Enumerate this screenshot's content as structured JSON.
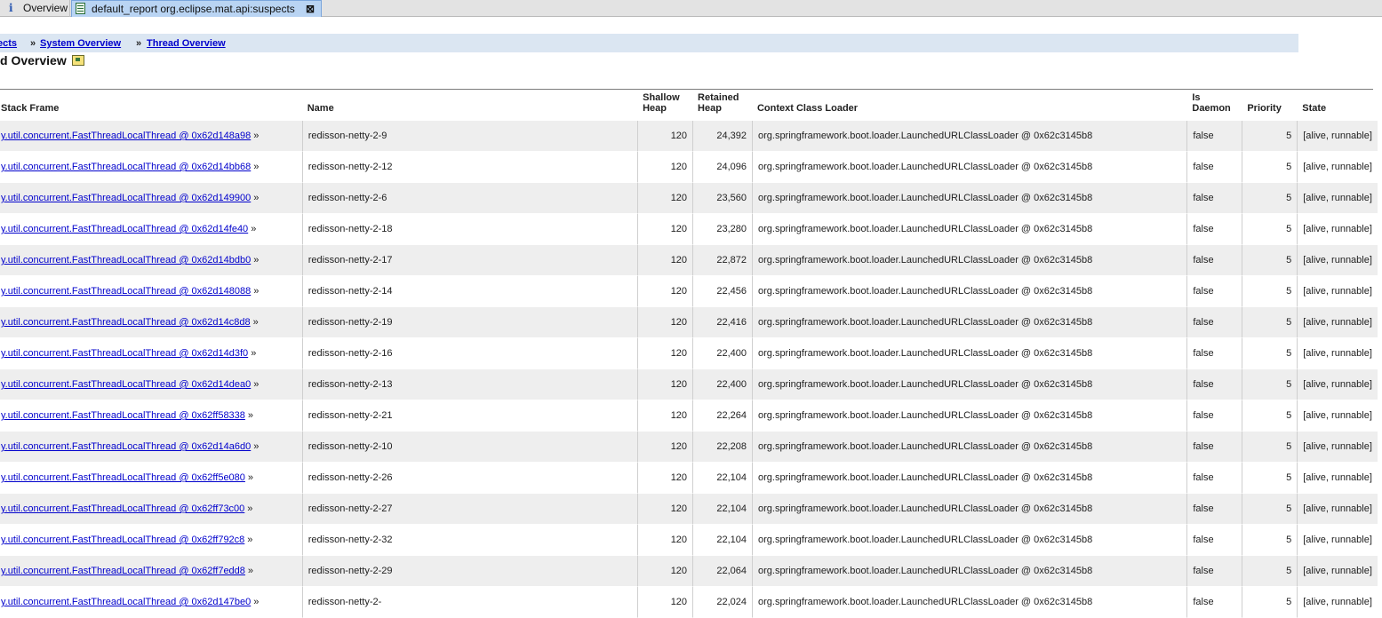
{
  "tabs": [
    {
      "label": "Overview",
      "icon": "info-icon"
    },
    {
      "label": "default_report  org.eclipse.mat.api:suspects",
      "icon": "report-icon",
      "close": "⊠"
    }
  ],
  "breadcrumb": {
    "sep": "»",
    "items": [
      "ects",
      "System Overview",
      "Thread Overview"
    ]
  },
  "page_title": "d Overview",
  "table": {
    "headers": {
      "frame": "Stack Frame",
      "name": "Name",
      "shallow": "Shallow Heap",
      "retained": "Retained Heap",
      "loader": "Context Class Loader",
      "daemon": "Is Daemon",
      "priority": "Priority",
      "state": "State"
    },
    "rows": [
      {
        "frame": "y.util.concurrent.FastThreadLocalThread @ 0x62d148a98",
        "name": "redisson-netty-2-9",
        "shallow": "120",
        "retained": "24,392",
        "loader": "org.springframework.boot.loader.LaunchedURLClassLoader @ 0x62c3145b8",
        "daemon": "false",
        "priority": "5",
        "state": "[alive, runnable]"
      },
      {
        "frame": "y.util.concurrent.FastThreadLocalThread @ 0x62d14bb68",
        "name": "redisson-netty-2-12",
        "shallow": "120",
        "retained": "24,096",
        "loader": "org.springframework.boot.loader.LaunchedURLClassLoader @ 0x62c3145b8",
        "daemon": "false",
        "priority": "5",
        "state": "[alive, runnable]"
      },
      {
        "frame": "y.util.concurrent.FastThreadLocalThread @ 0x62d149900",
        "name": "redisson-netty-2-6",
        "shallow": "120",
        "retained": "23,560",
        "loader": "org.springframework.boot.loader.LaunchedURLClassLoader @ 0x62c3145b8",
        "daemon": "false",
        "priority": "5",
        "state": "[alive, runnable]"
      },
      {
        "frame": "y.util.concurrent.FastThreadLocalThread @ 0x62d14fe40",
        "name": "redisson-netty-2-18",
        "shallow": "120",
        "retained": "23,280",
        "loader": "org.springframework.boot.loader.LaunchedURLClassLoader @ 0x62c3145b8",
        "daemon": "false",
        "priority": "5",
        "state": "[alive, runnable]"
      },
      {
        "frame": "y.util.concurrent.FastThreadLocalThread @ 0x62d14bdb0",
        "name": "redisson-netty-2-17",
        "shallow": "120",
        "retained": "22,872",
        "loader": "org.springframework.boot.loader.LaunchedURLClassLoader @ 0x62c3145b8",
        "daemon": "false",
        "priority": "5",
        "state": "[alive, runnable]"
      },
      {
        "frame": "y.util.concurrent.FastThreadLocalThread @ 0x62d148088",
        "name": "redisson-netty-2-14",
        "shallow": "120",
        "retained": "22,456",
        "loader": "org.springframework.boot.loader.LaunchedURLClassLoader @ 0x62c3145b8",
        "daemon": "false",
        "priority": "5",
        "state": "[alive, runnable]"
      },
      {
        "frame": "y.util.concurrent.FastThreadLocalThread @ 0x62d14c8d8",
        "name": "redisson-netty-2-19",
        "shallow": "120",
        "retained": "22,416",
        "loader": "org.springframework.boot.loader.LaunchedURLClassLoader @ 0x62c3145b8",
        "daemon": "false",
        "priority": "5",
        "state": "[alive, runnable]"
      },
      {
        "frame": "y.util.concurrent.FastThreadLocalThread @ 0x62d14d3f0",
        "name": "redisson-netty-2-16",
        "shallow": "120",
        "retained": "22,400",
        "loader": "org.springframework.boot.loader.LaunchedURLClassLoader @ 0x62c3145b8",
        "daemon": "false",
        "priority": "5",
        "state": "[alive, runnable]"
      },
      {
        "frame": "y.util.concurrent.FastThreadLocalThread @ 0x62d14dea0",
        "name": "redisson-netty-2-13",
        "shallow": "120",
        "retained": "22,400",
        "loader": "org.springframework.boot.loader.LaunchedURLClassLoader @ 0x62c3145b8",
        "daemon": "false",
        "priority": "5",
        "state": "[alive, runnable]"
      },
      {
        "frame": "y.util.concurrent.FastThreadLocalThread @ 0x62ff58338",
        "name": "redisson-netty-2-21",
        "shallow": "120",
        "retained": "22,264",
        "loader": "org.springframework.boot.loader.LaunchedURLClassLoader @ 0x62c3145b8",
        "daemon": "false",
        "priority": "5",
        "state": "[alive, runnable]"
      },
      {
        "frame": "y.util.concurrent.FastThreadLocalThread @ 0x62d14a6d0",
        "name": "redisson-netty-2-10",
        "shallow": "120",
        "retained": "22,208",
        "loader": "org.springframework.boot.loader.LaunchedURLClassLoader @ 0x62c3145b8",
        "daemon": "false",
        "priority": "5",
        "state": "[alive, runnable]"
      },
      {
        "frame": "y.util.concurrent.FastThreadLocalThread @ 0x62ff5e080",
        "name": "redisson-netty-2-26",
        "shallow": "120",
        "retained": "22,104",
        "loader": "org.springframework.boot.loader.LaunchedURLClassLoader @ 0x62c3145b8",
        "daemon": "false",
        "priority": "5",
        "state": "[alive, runnable]"
      },
      {
        "frame": "y.util.concurrent.FastThreadLocalThread @ 0x62ff73c00",
        "name": "redisson-netty-2-27",
        "shallow": "120",
        "retained": "22,104",
        "loader": "org.springframework.boot.loader.LaunchedURLClassLoader @ 0x62c3145b8",
        "daemon": "false",
        "priority": "5",
        "state": "[alive, runnable]"
      },
      {
        "frame": "y.util.concurrent.FastThreadLocalThread @ 0x62ff792c8",
        "name": "redisson-netty-2-32",
        "shallow": "120",
        "retained": "22,104",
        "loader": "org.springframework.boot.loader.LaunchedURLClassLoader @ 0x62c3145b8",
        "daemon": "false",
        "priority": "5",
        "state": "[alive, runnable]"
      },
      {
        "frame": "y.util.concurrent.FastThreadLocalThread @ 0x62ff7edd8",
        "name": "redisson-netty-2-29",
        "shallow": "120",
        "retained": "22,064",
        "loader": "org.springframework.boot.loader.LaunchedURLClassLoader @ 0x62c3145b8",
        "daemon": "false",
        "priority": "5",
        "state": "[alive, runnable]"
      },
      {
        "frame": "y.util.concurrent.FastThreadLocalThread @ 0x62d147be0",
        "name": "redisson-netty-2-",
        "shallow": "120",
        "retained": "22,024",
        "loader": "org.springframework.boot.loader.LaunchedURLClassLoader @ 0x62c3145b8",
        "daemon": "false",
        "priority": "5",
        "state": "[alive, runnable]"
      }
    ]
  }
}
